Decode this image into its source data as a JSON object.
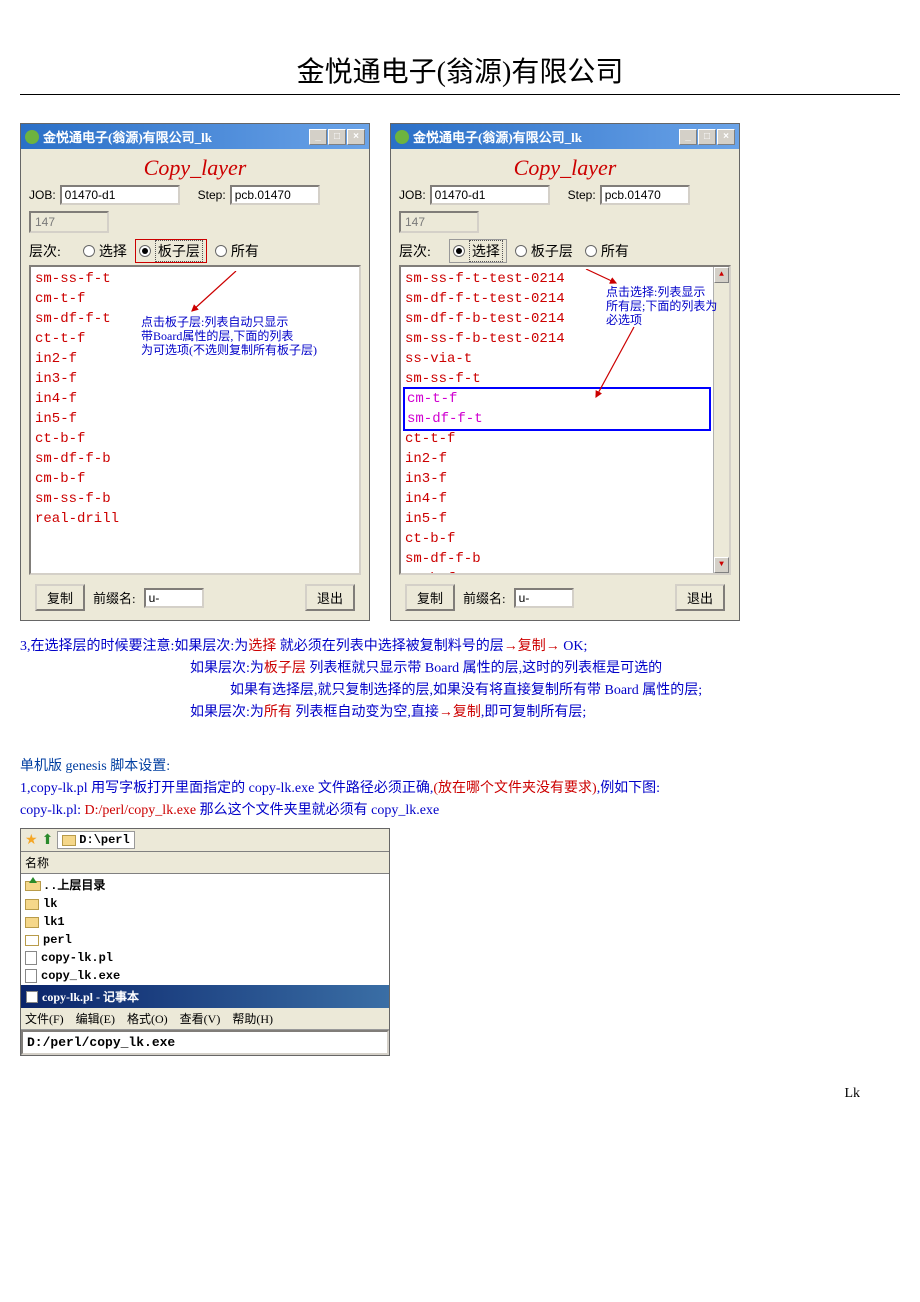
{
  "title": "金悦通电子(翁源)有限公司",
  "window_title": "金悦通电子(翁源)有限公司_lk",
  "copy_layer": "Copy_layer",
  "labels": {
    "job": "JOB:",
    "step": "Step:",
    "level": "层次:",
    "select": "选择",
    "board": "板子层",
    "all": "所有",
    "copy": "复制",
    "prefix": "前缀名:",
    "exit": "退出"
  },
  "job_value": "01470-d1",
  "step_value": "pcb.01470",
  "num_value": "147",
  "prefix_value": "u-",
  "left_list": [
    "sm-ss-f-t",
    "cm-t-f",
    "sm-df-f-t",
    "ct-t-f",
    "in2-f",
    "in3-f",
    "in4-f",
    "in5-f",
    "ct-b-f",
    "sm-df-f-b",
    "cm-b-f",
    "sm-ss-f-b",
    "real-drill"
  ],
  "right_list_a": [
    "sm-ss-f-t-test-0214",
    "sm-df-f-t-test-0214",
    "sm-df-f-b-test-0214",
    "sm-ss-f-b-test-0214",
    "ss-via-t",
    "sm-ss-f-t"
  ],
  "right_list_sel": [
    "cm-t-f",
    "sm-df-f-t"
  ],
  "right_list_b": [
    "ct-t-f",
    "in2-f",
    "in3-f",
    "in4-f",
    "in5-f",
    "ct-b-f",
    "sm-df-f-b",
    "cm-b-f"
  ],
  "annot_left_1": "点击板子层:列表自动只显示",
  "annot_left_2": "带Board属性的层,下面的列表",
  "annot_left_3": "为可选项(不选则复制所有板子层)",
  "annot_right_1": "点击选择:列表显示",
  "annot_right_2": "所有层;下面的列表为",
  "annot_right_3": "必选项",
  "notes": {
    "l1a": "3,在选择层的时候要注意:如果层次:为",
    "l1b": "选择",
    "l1c": " 就必须在列表中选择被复制料号的层",
    "l1d": "→复制→",
    "l1e": " OK;",
    "l2a": "如果层次:为",
    "l2b": "板子层",
    "l2c": " 列表框就只显示带 Board 属性的层,这时的列表框是可选的",
    "l3": "如果有选择层,就只复制选择的层,如果没有将直接复制所有带 Board 属性的层;",
    "l4a": "如果层次:为",
    "l4b": "所有",
    "l4c": " 列表框自动变为空,直接",
    "l4d": "→复制",
    "l4e": ",即可复制所有层;"
  },
  "section2": {
    "h": "单机版 genesis 脚本设置:",
    "l1a": "1,copy-lk.pl 用写字板打开里面指定的 copy-lk.exe 文件路径必须正确,",
    "l1b": "(放在哪个文件夹没有要求)",
    "l1c": ",例如下图:",
    "l2a": "copy-lk.pl: ",
    "l2b": "D:/perl/copy_lk.exe",
    "l2c": "   那么这个文件夹里就必须有 copy_lk.exe"
  },
  "explorer": {
    "path": "D:\\perl",
    "col": "名称",
    "up": "..上层目录",
    "rows": [
      "lk",
      "lk1",
      "perl",
      "copy-lk.pl",
      "copy_lk.exe"
    ]
  },
  "notepad": {
    "title": "copy-lk.pl - 记事本",
    "menu": [
      "文件(F)",
      "编辑(E)",
      "格式(O)",
      "查看(V)",
      "帮助(H)"
    ],
    "content": "D:/perl/copy_lk.exe"
  },
  "lk": "Lk"
}
